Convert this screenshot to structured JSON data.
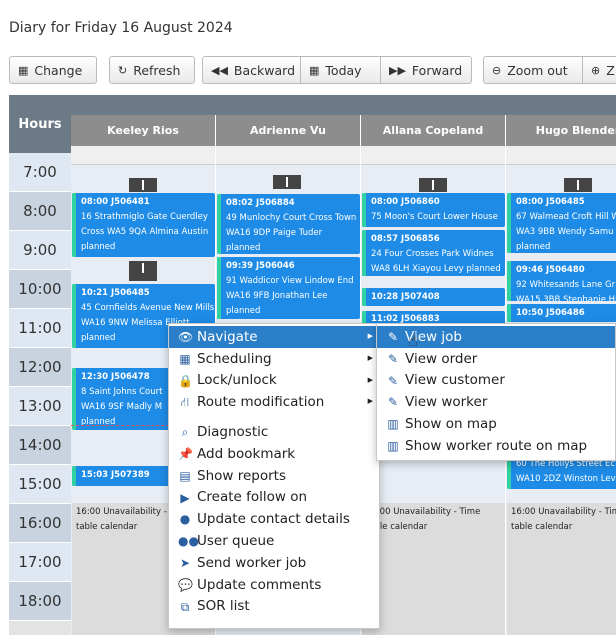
{
  "page": {
    "title": "Diary for Friday 16 August 2024"
  },
  "toolbar": {
    "change": "Change",
    "refresh": "Refresh",
    "backward": "Backward",
    "today": "Today",
    "forward": "Forward",
    "zoom_out": "Zoom out",
    "zoom_in_partial": "Z"
  },
  "grid": {
    "hours_label": "Hours",
    "workers": [
      "Keeley Rios",
      "Adrienne Vu",
      "Allana Copeland",
      "Hugo Blender"
    ],
    "hours": [
      "7:00",
      "8:00",
      "9:00",
      "10:00",
      "11:00",
      "12:00",
      "13:00",
      "14:00",
      "15:00",
      "16:00",
      "17:00",
      "18:00"
    ]
  },
  "jobs": {
    "k1": {
      "h": "08:00 J506481",
      "l1": "16 Strathmiglo Gate Cuerdley",
      "l2": "Cross WA5 9QA Almina Austin",
      "l3": "planned"
    },
    "k2": {
      "h": "10:21 J506485",
      "l1": "45 Cornfields Avenue New Mills",
      "l2": "WA16 9NW Melissa Elliott",
      "l3": "planned"
    },
    "k3": {
      "h": "12:30 J506478",
      "l1": "8 Saint Johns Court",
      "l2": "WA16 9SF Madly M",
      "l3": "planned"
    },
    "k4": {
      "h": "15:03 J507389"
    },
    "a1": {
      "h": "08:02 J506884",
      "l1": "49 Munlochy Court Cross Town",
      "l2": "WA16 9DP Paige Tuder",
      "l3": "planned"
    },
    "a2": {
      "h": "09:39 J506046",
      "l1": "91 Waddicor View Lindow End",
      "l2": "WA16 9FB Jonathan Lee",
      "l3": "planned"
    },
    "c1": {
      "h": "08:00 J506860",
      "l1": "75 Moon's Court Lower House"
    },
    "c2": {
      "h": "08:57 J506856",
      "l1": "24 Four Crosses Park Widnes",
      "l2": "WA8 6LH Xiayou Levy planned"
    },
    "c3": {
      "h": "10:28 J507408"
    },
    "c4": {
      "h": "11:02 J506883"
    },
    "h1": {
      "h": "08:00 J506485",
      "l1": "67 Walmead Croft Hill W",
      "l2": "WA3 9BB Wendy Samu",
      "l3": "planned"
    },
    "h2": {
      "h": "09:46 J506480",
      "l1": "92 Whitesands Lane Gr",
      "l2": "WA15 3BB Stephanie Hi"
    },
    "h3": {
      "h": "10:50 J506486"
    },
    "h4": {
      "l1": "60 The Hollys Street Ec",
      "l2": "WA10 2DZ Winston Lev"
    }
  },
  "unavailability": {
    "k": {
      "l1": "16:00 Unavailability - Time",
      "l2": "table calendar"
    },
    "c": {
      "l1": "16:00 Unavailability - Time",
      "l2": "table calendar"
    },
    "h": {
      "l1": "16:00 Unavailability - Tim",
      "l2": "table calendar"
    }
  },
  "context_menu": {
    "items": [
      {
        "label": "Navigate",
        "icon": "eye-icon"
      },
      {
        "label": "Scheduling",
        "icon": "calendar-icon"
      },
      {
        "label": "Lock/unlock",
        "icon": "lock-icon"
      },
      {
        "label": "Route modification",
        "icon": "road-icon"
      },
      {
        "label": "Diagnostic",
        "icon": "search-icon"
      },
      {
        "label": "Add bookmark",
        "icon": "pin-icon"
      },
      {
        "label": "Show reports",
        "icon": "report-icon"
      },
      {
        "label": "Create follow on",
        "icon": "forward-icon"
      },
      {
        "label": "Update contact details",
        "icon": "user-icon"
      },
      {
        "label": "User queue",
        "icon": "users-icon"
      },
      {
        "label": "Send worker job",
        "icon": "send-icon"
      },
      {
        "label": "Update comments",
        "icon": "comment-icon"
      },
      {
        "label": "SOR list",
        "icon": "copy-icon"
      }
    ]
  },
  "submenu": {
    "items": [
      {
        "label": "View job",
        "icon": "edit-icon"
      },
      {
        "label": "View order",
        "icon": "edit-icon"
      },
      {
        "label": "View customer",
        "icon": "edit-icon"
      },
      {
        "label": "View worker",
        "icon": "edit-icon"
      },
      {
        "label": "Show on map",
        "icon": "map-icon"
      },
      {
        "label": "Show worker route on map",
        "icon": "map-icon"
      }
    ]
  }
}
